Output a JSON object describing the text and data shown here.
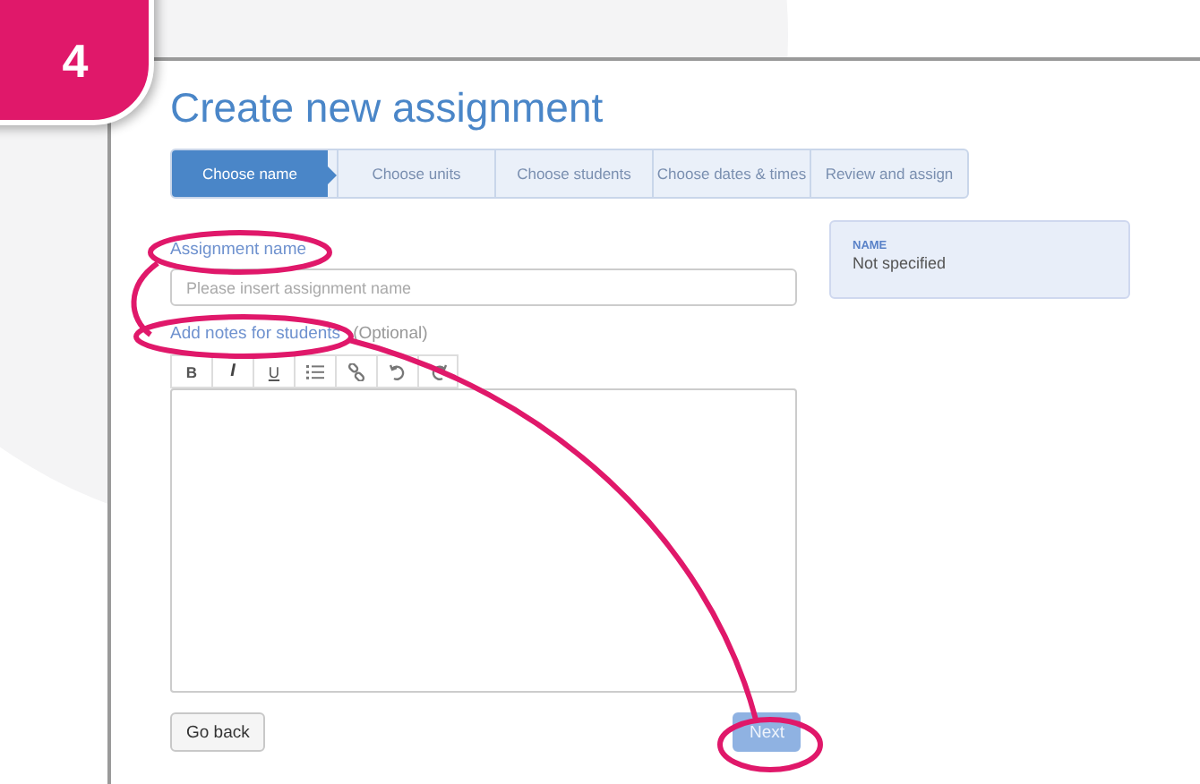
{
  "step_badge": "4",
  "title": "Create new assignment",
  "steps": [
    {
      "label": "Choose name",
      "selected": true
    },
    {
      "label": "Choose units",
      "selected": false
    },
    {
      "label": "Choose students",
      "selected": false
    },
    {
      "label": "Choose dates & times",
      "selected": false
    },
    {
      "label": "Review and assign",
      "selected": false
    }
  ],
  "name_field": {
    "label": "Assignment name",
    "placeholder": "Please insert assignment name"
  },
  "notes_field": {
    "label": "Add notes for students",
    "hint": "(Optional)"
  },
  "toolbar": [
    {
      "kind": "text",
      "text": "B"
    },
    {
      "kind": "text",
      "text": "I"
    },
    {
      "kind": "text",
      "text": "U"
    },
    {
      "kind": "list"
    },
    {
      "kind": "link"
    },
    {
      "kind": "undo"
    },
    {
      "kind": "redo"
    }
  ],
  "summary": {
    "heading": "NAME",
    "value": "Not specified"
  },
  "buttons": {
    "back": "Go back",
    "next": "Next",
    "next_disabled": true
  }
}
